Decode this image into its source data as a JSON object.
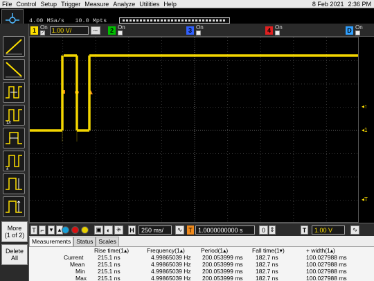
{
  "menu": {
    "items": [
      "File",
      "Control",
      "Setup",
      "Trigger",
      "Measure",
      "Analyze",
      "Utilities",
      "Help"
    ],
    "date": "8 Feb 2021",
    "time": "2:36 PM"
  },
  "acquisition": {
    "sample_rate": "4.00 MSa/s",
    "memory": "10.0 Mpts"
  },
  "channels": [
    {
      "number": "1",
      "label": "On",
      "checked": true,
      "scale": "1.00 V/",
      "color": "#ffe000"
    },
    {
      "number": "2",
      "label": "On",
      "checked": false,
      "color": "#00c000"
    },
    {
      "number": "3",
      "label": "On",
      "checked": false,
      "color": "#3060ff"
    },
    {
      "number": "4",
      "label": "On",
      "checked": false,
      "color": "#e02020"
    },
    {
      "number": "D",
      "label": "On",
      "checked": false,
      "color": "#30a0ff"
    }
  ],
  "left_toolbar": {
    "more_label": "More",
    "more_page": "(1 of 2)",
    "delete_label": "Delete",
    "delete_sub": "All"
  },
  "horizontal": {
    "t_label": "T",
    "h_label": "H",
    "timebase": "250 ms/",
    "position": "1.0000000000 s",
    "trigger_label": "T",
    "trigger_level": "1.00 V"
  },
  "measurements": {
    "tabs": [
      "Measurements",
      "Status",
      "Scales"
    ],
    "headers": [
      "Rise time(1▴)",
      "Frequency(1▴)",
      "Period(1▴)",
      "Fall time(1▾)",
      "+ width(1▴)"
    ],
    "rows": [
      {
        "label": "Current",
        "values": [
          "215.1 ns",
          "4.99865039 Hz",
          "200.053999 ms",
          "182.7 ns",
          "100.027988 ms"
        ]
      },
      {
        "label": "Mean",
        "values": [
          "215.1 ns",
          "4.99865039 Hz",
          "200.053999 ms",
          "182.7 ns",
          "100.027988 ms"
        ]
      },
      {
        "label": "Min",
        "values": [
          "215.1 ns",
          "4.99865039 Hz",
          "200.053999 ms",
          "182.7 ns",
          "100.027988 ms"
        ]
      },
      {
        "label": "Max",
        "values": [
          "215.1 ns",
          "4.99865039 Hz",
          "200.053999 ms",
          "182.7 ns",
          "100.027988 ms"
        ]
      }
    ]
  }
}
